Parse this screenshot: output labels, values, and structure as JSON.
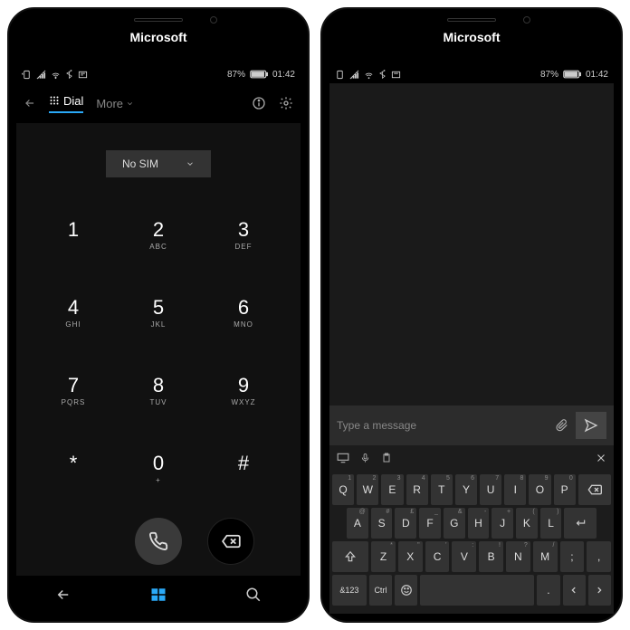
{
  "brand": "Microsoft",
  "status": {
    "battery": "87%",
    "time": "01:42"
  },
  "dialer": {
    "tab": "Dial",
    "more": "More",
    "sim": "No SIM",
    "keys": [
      {
        "d": "1",
        "s": ""
      },
      {
        "d": "2",
        "s": "ABC"
      },
      {
        "d": "3",
        "s": "DEF"
      },
      {
        "d": "4",
        "s": "GHI"
      },
      {
        "d": "5",
        "s": "JKL"
      },
      {
        "d": "6",
        "s": "MNO"
      },
      {
        "d": "7",
        "s": "PQRS"
      },
      {
        "d": "8",
        "s": "TUV"
      },
      {
        "d": "9",
        "s": "WXYZ"
      },
      {
        "d": "*",
        "s": ""
      },
      {
        "d": "0",
        "s": "+"
      },
      {
        "d": "#",
        "s": ""
      }
    ]
  },
  "msg": {
    "placeholder": "Type a message"
  },
  "kb": {
    "row1": [
      {
        "k": "Q",
        "a": "1"
      },
      {
        "k": "W",
        "a": "2"
      },
      {
        "k": "E",
        "a": "3"
      },
      {
        "k": "R",
        "a": "4"
      },
      {
        "k": "T",
        "a": "5"
      },
      {
        "k": "Y",
        "a": "6"
      },
      {
        "k": "U",
        "a": "7"
      },
      {
        "k": "I",
        "a": "8"
      },
      {
        "k": "O",
        "a": "9"
      },
      {
        "k": "P",
        "a": "0"
      }
    ],
    "row2": [
      {
        "k": "A",
        "a": "@"
      },
      {
        "k": "S",
        "a": "#"
      },
      {
        "k": "D",
        "a": "£"
      },
      {
        "k": "F",
        "a": "_"
      },
      {
        "k": "G",
        "a": "&"
      },
      {
        "k": "H",
        "a": "-"
      },
      {
        "k": "J",
        "a": "+"
      },
      {
        "k": "K",
        "a": "("
      },
      {
        "k": "L",
        "a": ")"
      }
    ],
    "row3": [
      {
        "k": "Z",
        "a": "*"
      },
      {
        "k": "X",
        "a": "\""
      },
      {
        "k": "C",
        "a": "'"
      },
      {
        "k": "V",
        "a": ":"
      },
      {
        "k": "B",
        "a": "!"
      },
      {
        "k": "N",
        "a": "?"
      },
      {
        "k": "M",
        "a": "/"
      },
      {
        "k": ";",
        "a": ""
      },
      {
        "k": ",",
        "a": ""
      }
    ],
    "sym": "&123",
    "ctrl": "Ctrl",
    "period": "."
  }
}
